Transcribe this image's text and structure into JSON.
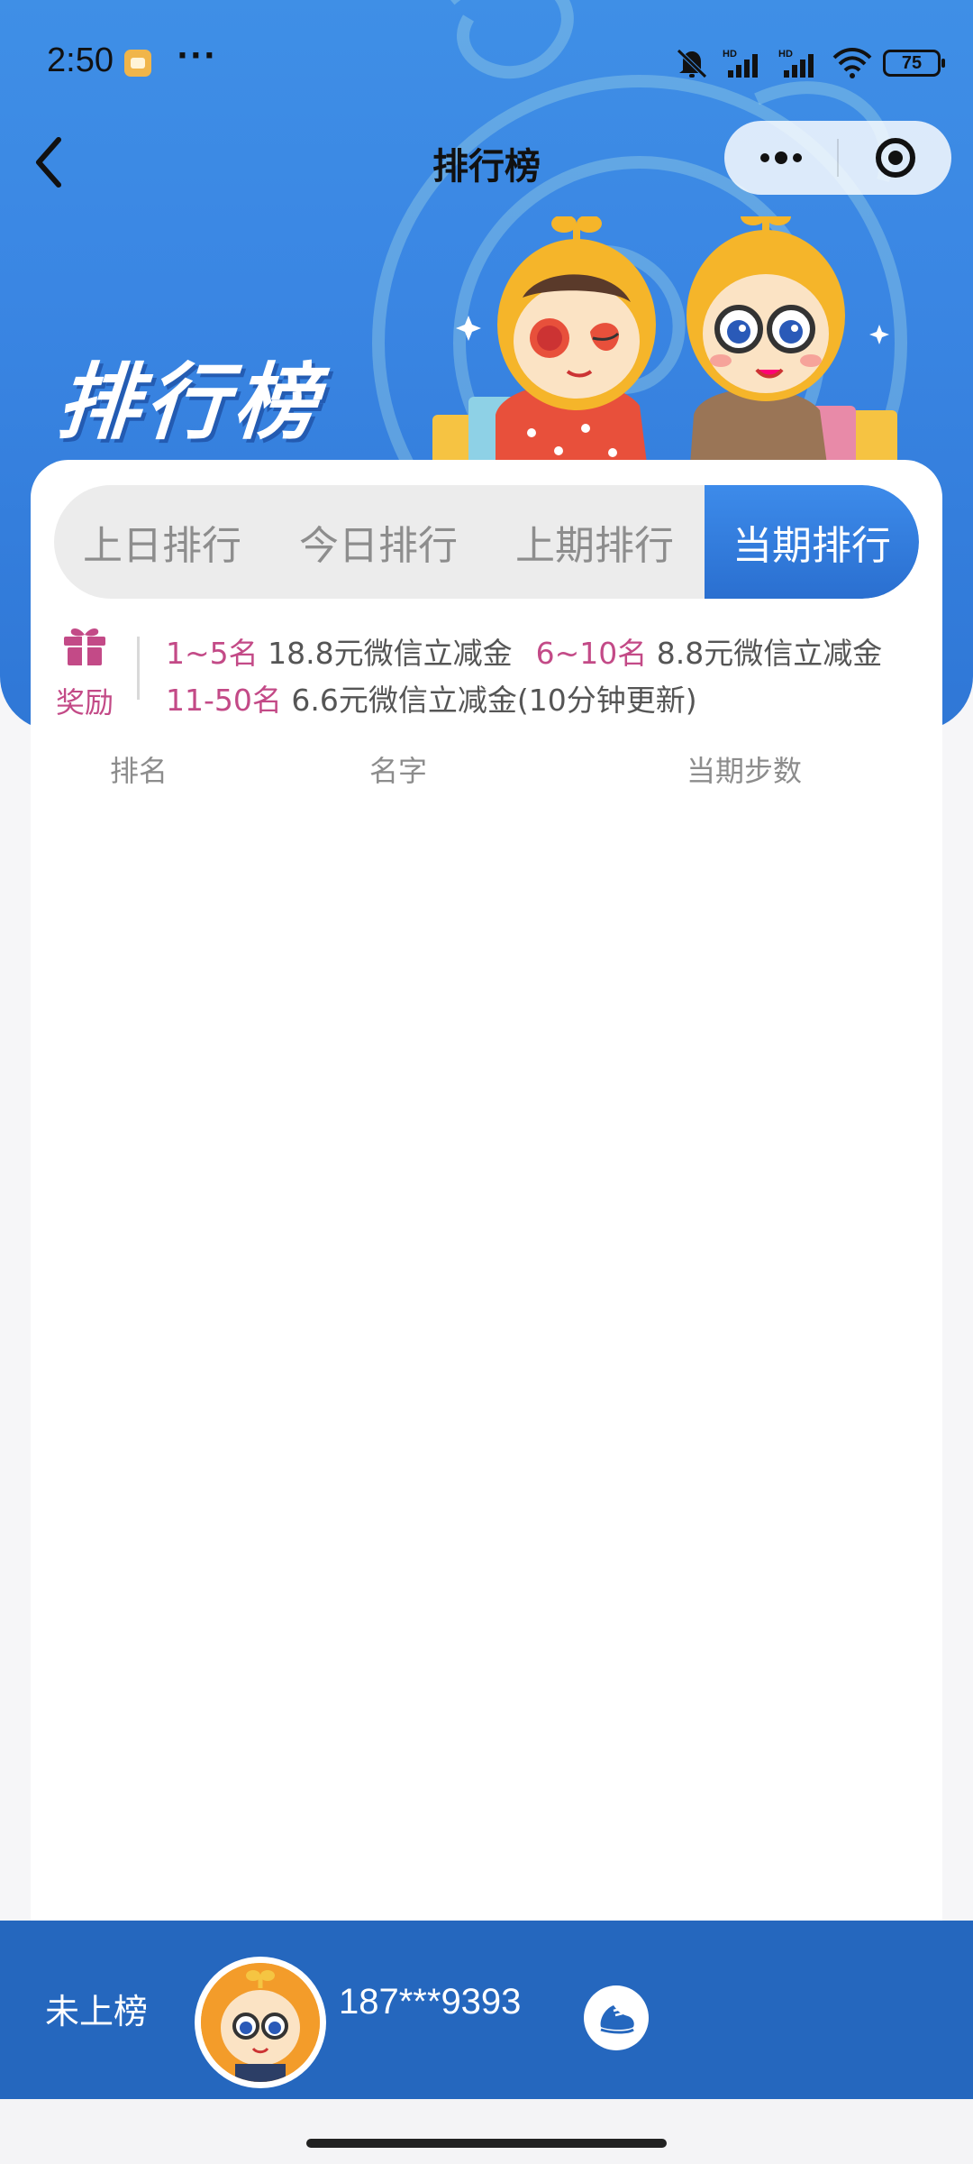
{
  "status_bar": {
    "time": "2:50",
    "more": "···",
    "battery": "75"
  },
  "nav": {
    "title": "排行榜"
  },
  "hero": {
    "title": "排行榜"
  },
  "tabs": [
    {
      "label": "上日排行",
      "active": false
    },
    {
      "label": "今日排行",
      "active": false
    },
    {
      "label": "上期排行",
      "active": false
    },
    {
      "label": "当期排行",
      "active": true
    }
  ],
  "reward": {
    "label": "奖励",
    "line1": {
      "rank_a": "1~5名",
      "prize_a": "18.8元微信立减金",
      "rank_b": "6~10名",
      "prize_b": "8.8元微信立减金"
    },
    "line2": {
      "rank": "11-50名",
      "prize": "6.6元微信立减金(10分钟更新)"
    }
  },
  "table": {
    "headers": [
      "排名",
      "名字",
      "当期步数"
    ],
    "rows": []
  },
  "me": {
    "rank_status": "未上榜",
    "phone": "187***9393"
  },
  "colors": {
    "primary": "#2f77d6",
    "accent_pink": "#c34a87",
    "bottom_bar": "#2567be"
  },
  "icons": [
    "back-chevron-icon",
    "more-dots-icon",
    "close-target-icon",
    "gift-icon",
    "shoe-icon"
  ]
}
